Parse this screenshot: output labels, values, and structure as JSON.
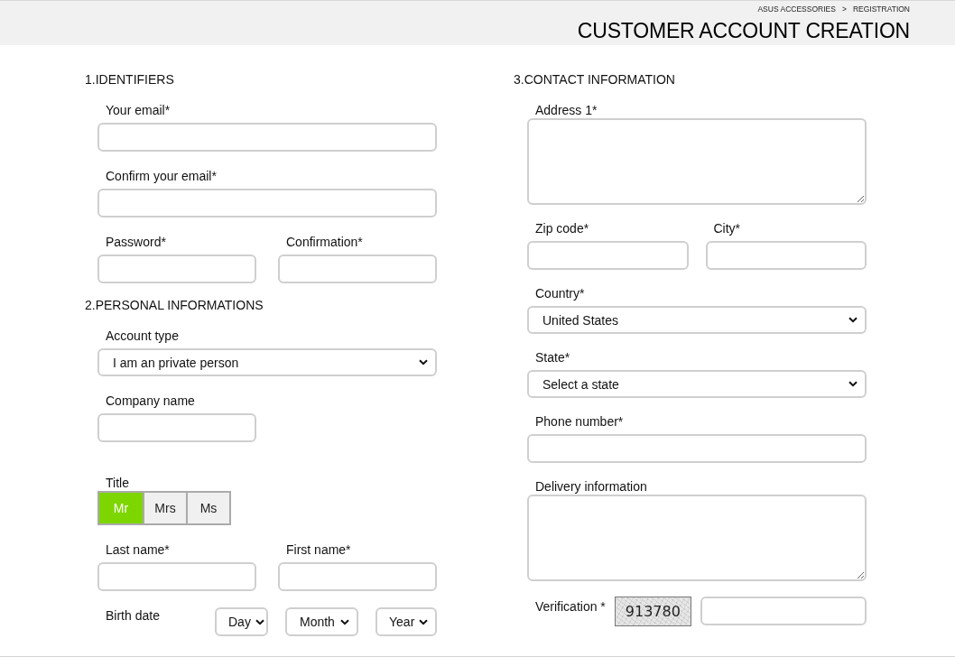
{
  "header": {
    "breadcrumb": {
      "items": [
        "ASUS ACCESSORIES",
        "REGISTRATION"
      ],
      "separator": ">"
    },
    "title": "CUSTOMER ACCOUNT CREATION"
  },
  "columns": [
    {
      "sections": [
        {
          "heading": "1.IDENTIFIERS",
          "rows": [
            [
              {
                "kind": "input",
                "label": "Your email*"
              }
            ],
            [
              {
                "kind": "input",
                "label": "Confirm your email*"
              }
            ],
            [
              {
                "kind": "input",
                "label": "Password*"
              },
              {
                "kind": "input",
                "label": "Confirmation*"
              }
            ]
          ]
        },
        {
          "heading": "2.PERSONAL INFORMATIONS",
          "rows": [
            [
              {
                "kind": "select",
                "label": "Account type",
                "value": "I am an private person"
              }
            ],
            [
              {
                "kind": "short",
                "label": "Company name"
              }
            ],
            [
              {
                "kind": "choice",
                "label": "Title",
                "options": [
                  {
                    "label": "Mr",
                    "selected": true
                  },
                  {
                    "label": "Mrs",
                    "selected": false
                  },
                  {
                    "label": "Ms",
                    "selected": false
                  }
                ]
              }
            ],
            [
              {
                "kind": "input",
                "label": "Last name*"
              },
              {
                "kind": "input",
                "label": "First name*"
              }
            ],
            [
              {
                "kind": "date",
                "label": "Birth date",
                "selects": [
                  "Day",
                  "Month",
                  "Year"
                ]
              }
            ]
          ]
        }
      ]
    },
    {
      "sections": [
        {
          "heading": "3.CONTACT INFORMATION",
          "rows": [
            [
              {
                "kind": "textarea",
                "label": "Address 1*"
              }
            ],
            [
              {
                "kind": "input",
                "label": "Zip code*"
              },
              {
                "kind": "input",
                "label": "City*"
              }
            ],
            [
              {
                "kind": "select",
                "label": "Country*",
                "value": "United States"
              }
            ],
            [
              {
                "kind": "select",
                "label": "State*",
                "value": "Select a state"
              }
            ],
            [
              {
                "kind": "input",
                "label": "Phone number*"
              }
            ],
            [
              {
                "kind": "textarea",
                "label": "Delivery information"
              }
            ],
            [
              {
                "kind": "captcha",
                "label": "Verification *",
                "code": "913780"
              }
            ]
          ]
        }
      ]
    }
  ]
}
